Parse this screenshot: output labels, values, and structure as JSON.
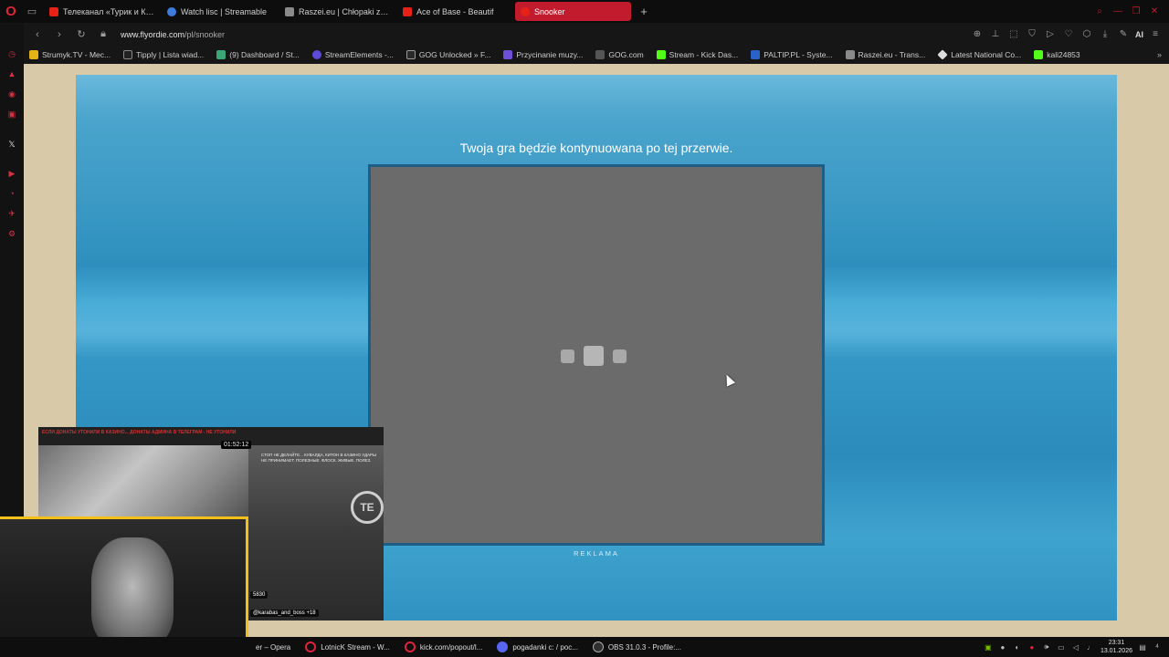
{
  "browser": {
    "tabs": [
      {
        "label": "Телеканал «Турик и Конь",
        "favicon_color": "#e62117",
        "active": false
      },
      {
        "label": "Watch lisc | Streamable",
        "favicon_color": "#3b7ddd",
        "active": false
      },
      {
        "label": "Raszei.eu | Chłopaki z Ra",
        "favicon_color": "#8a8a8a",
        "active": false
      },
      {
        "label": "Ace of Base - Beautif",
        "favicon_color": "#e62117",
        "active": false
      },
      {
        "label": "Snooker",
        "favicon_color": "#e62117",
        "active": true
      }
    ],
    "new_tab_label": "+",
    "address": {
      "url_host": "www.flyordie.com",
      "url_path": "/pl/snooker"
    },
    "ai_label": "AI",
    "bookmarks": [
      {
        "label": "Strumyk.TV - Mec...",
        "color": "#e5b316"
      },
      {
        "label": "Tipply | Lista wiad...",
        "color": "#222222"
      },
      {
        "label": "(9) Dashboard / St...",
        "color": "#3aa675"
      },
      {
        "label": "StreamElements -...",
        "color": "#5b4bd6"
      },
      {
        "label": "GOG Unlocked » F...",
        "color": "#2a2a2a"
      },
      {
        "label": "Przycinanie muzy...",
        "color": "#6e4fd8"
      },
      {
        "label": "GOG.com",
        "color": "#555555"
      },
      {
        "label": "Stream - Kick Das...",
        "color": "#53fc18"
      },
      {
        "label": "PALTIP.PL - Syste...",
        "color": "#2a63c7"
      },
      {
        "label": "Raszei.eu - Trans...",
        "color": "#8a8a8a"
      },
      {
        "label": "Latest National Co...",
        "color": "#dddddd"
      },
      {
        "label": "kali24853",
        "color": "#53fc18"
      }
    ],
    "bookmarks_more": "»"
  },
  "game": {
    "interlude_text": "Twoja gra będzie kontynuowana po tej przerwie.",
    "ad_label": "REKLAMA",
    "background_color": "#3f9cc6"
  },
  "stream": {
    "ticker": "ЕСЛИ ДОНАТЫ УТОНИЛИ В КАЗИНО... ДОНАТЫ АДМИНА В ТЕЛЕГРАМ - НЕ УТОНИЛИ",
    "timer": "01:52:12",
    "chat_lines": "СТОП НЕ ДЕЛАЙТЕ... КУВАЛДА, КИТОН В КАЗИНО УДАРЫ НЕ ПРИНИМАЕТ. ПОЛЕЗНЫЕ. ФЛОСК. ЖИВЫЕ. ПОЛЕЗ.",
    "logo": "TE",
    "viewers": "5830",
    "handle": "@karabas_and_boss",
    "age": "+18"
  },
  "taskbar": {
    "items": [
      {
        "label": "er – Opera",
        "color": "#e0233a"
      },
      {
        "label": "LotnicK Stream - W...",
        "color": "#e0233a"
      },
      {
        "label": "kick.com/popout/l...",
        "color": "#e0233a"
      },
      {
        "label": "pogadanki c: / poc...",
        "color": "#5865f2"
      },
      {
        "label": "OBS 31.0.3 - Profile:...",
        "color": "#303030"
      }
    ],
    "time": "23:31",
    "date": "13.01.2026",
    "notifications": "4"
  }
}
